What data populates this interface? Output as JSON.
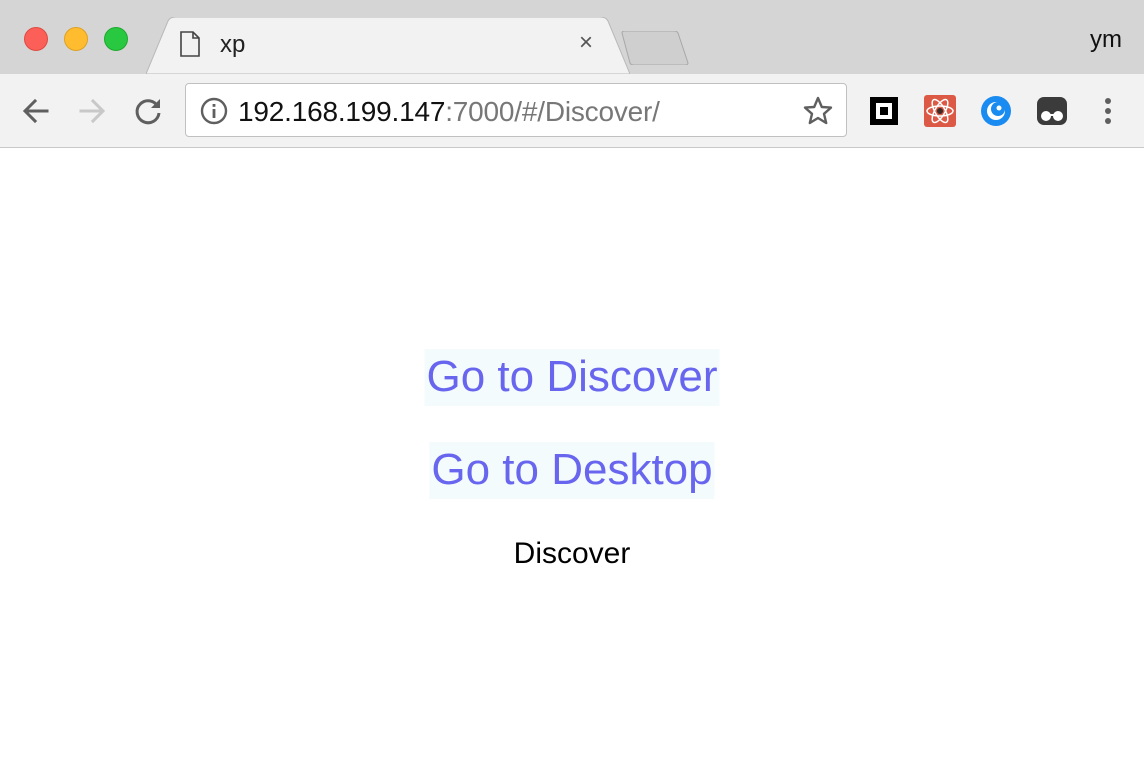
{
  "window": {
    "tab_title": "xp",
    "tab_close": "×",
    "profile_name": "ym"
  },
  "toolbar": {
    "url_host": "192.168.199.147",
    "url_rest": ":7000/#/Discover/",
    "icons": {
      "back": "arrow-left-icon",
      "forward": "arrow-right-icon",
      "reload": "reload-icon",
      "info": "info-icon",
      "bookmark": "star-icon",
      "menu": "kebab-menu-icon"
    },
    "extensions": [
      "square-logo-icon",
      "react-devtools-icon",
      "blue-circle-ext-icon",
      "glasses-ext-icon"
    ]
  },
  "page": {
    "link_discover": "Go to Discover",
    "link_desktop": "Go to Desktop",
    "current_route": "Discover"
  },
  "colors": {
    "link_text": "#6866ee",
    "link_bg": "#f4fbfd",
    "tabstrip_bg": "#d5d5d5",
    "toolbar_bg": "#f2f2f2"
  }
}
